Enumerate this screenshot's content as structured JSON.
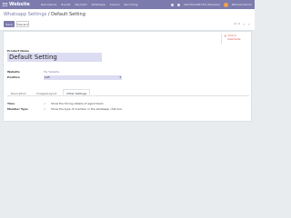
{
  "topbar": {
    "brand": "Website",
    "menu": [
      "Discussions",
      "Events",
      "Payment",
      "Whatsapp",
      "Invoice",
      "Recording"
    ],
    "right_text": "SAUTOCASE LTD (Preview)",
    "right_text2": "Mitchell Admin"
  },
  "control": {
    "breadcrumb_parent": "Whatsapp Settings",
    "breadcrumb_sep": " / ",
    "breadcrumb_current": "Default Setting",
    "save_label": "Save",
    "discard_label": "Discard",
    "pager": "1 / 1",
    "prev": "‹",
    "next": "›"
  },
  "form": {
    "smart_button_icon": "×",
    "smart_button_label": "Click to Deactivate",
    "product_name_label": "Product Name",
    "product_name_value": "Default Setting",
    "website_label": "Website",
    "website_value": "My Website",
    "position_label": "Position",
    "position_value": "Left",
    "caret": "▾"
  },
  "tabs": [
    "Description",
    "Images/Layout",
    "Other Settings"
  ],
  "active_tab": 2,
  "settings": [
    {
      "label": "Time",
      "mark": "✓",
      "desc": "Show the timing details of agent team"
    },
    {
      "label": "Member Type",
      "mark": "✓",
      "desc": "Show the type of member in the whatsapp chat box"
    }
  ],
  "colors": {
    "accent": "#7c7bad",
    "input_bg": "#dcdcf3",
    "danger": "#d9534f",
    "page_bg": "#e9ecef"
  }
}
